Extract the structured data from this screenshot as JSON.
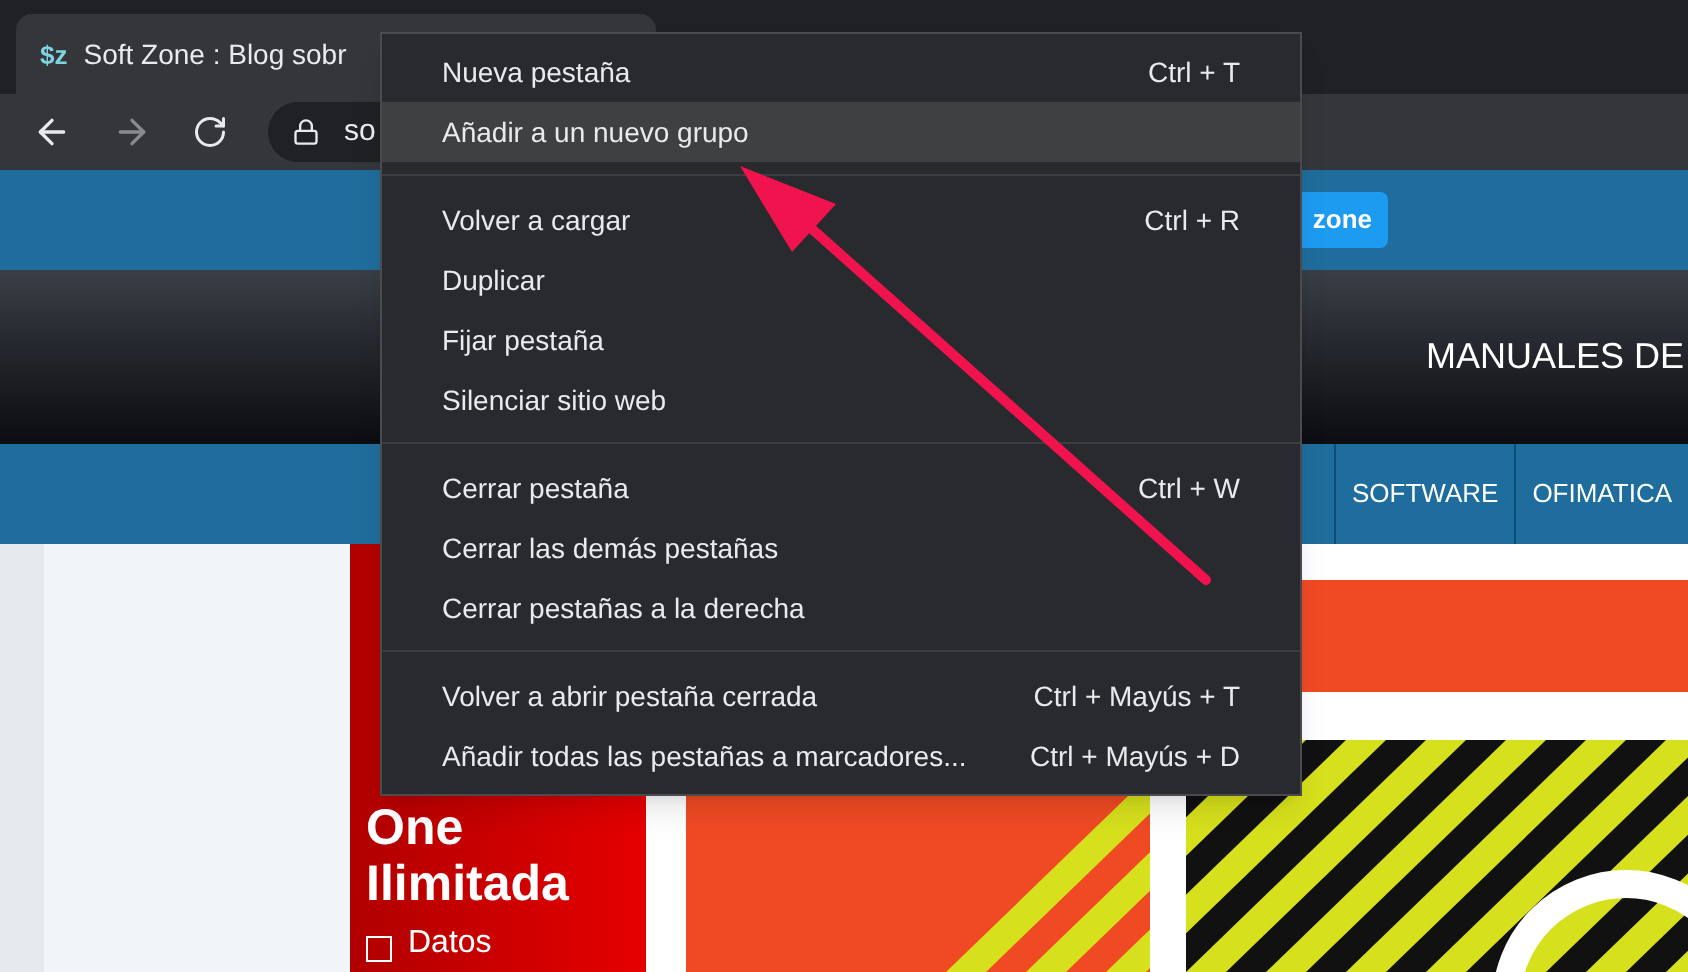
{
  "browser": {
    "tab": {
      "favicon": "$z",
      "title": "Soft Zone : Blog sobr"
    },
    "address": "so"
  },
  "site": {
    "badge": "zone",
    "header_text": "MANUALES DE",
    "nav": [
      {
        "label": "SOFTWARE"
      },
      {
        "label": "OFIMATICA"
      }
    ],
    "ad": {
      "title_lines": [
        "One",
        "Ilimitada"
      ],
      "bullet": "Datos"
    }
  },
  "context_menu": {
    "sections": [
      [
        {
          "label": "Nueva pestaña",
          "shortcut": "Ctrl + T",
          "selected": false
        },
        {
          "label": "Añadir a un nuevo grupo",
          "selected": true
        }
      ],
      [
        {
          "label": "Volver a cargar",
          "shortcut": "Ctrl + R",
          "selected": false
        },
        {
          "label": "Duplicar",
          "selected": false
        },
        {
          "label": "Fijar pestaña",
          "selected": false
        },
        {
          "label": "Silenciar sitio web",
          "selected": false
        }
      ],
      [
        {
          "label": "Cerrar pestaña",
          "shortcut": "Ctrl + W",
          "selected": false
        },
        {
          "label": "Cerrar las demás pestañas",
          "selected": false
        },
        {
          "label": "Cerrar pestañas a la derecha",
          "selected": false
        }
      ],
      [
        {
          "label": "Volver a abrir pestaña cerrada",
          "shortcut": "Ctrl + Mayús + T",
          "selected": false
        },
        {
          "label": "Añadir todas las pestañas a marcadores...",
          "shortcut": "Ctrl + Mayús + D",
          "selected": false
        }
      ]
    ]
  }
}
